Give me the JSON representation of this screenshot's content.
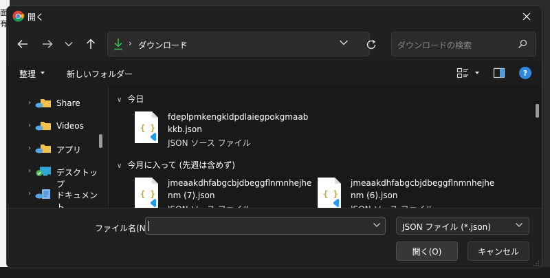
{
  "background": {
    "left_text": [
      "面",
      "有"
    ]
  },
  "window": {
    "title": "開く"
  },
  "nav": {
    "address_folder": "ダウンロード",
    "address_separator": "›",
    "search_placeholder": "ダウンロードの検索"
  },
  "toolbar": {
    "organize_label": "整理",
    "new_folder_label": "新しいフォルダー",
    "help_label": "?"
  },
  "sidebar": {
    "items": [
      {
        "label": "Share",
        "icon": "cloud-folder-icon"
      },
      {
        "label": "Videos",
        "icon": "cloud-folder-icon"
      },
      {
        "label": "アプリ",
        "icon": "cloud-folder-icon"
      },
      {
        "label": "デスクトップ",
        "icon": "desktop-synced-icon"
      },
      {
        "label": "ドキュメント",
        "icon": "documents-icon"
      }
    ]
  },
  "content": {
    "groups": [
      {
        "header": "今日",
        "files": [
          {
            "name": "fdeplpmkengkldpdlaiegpokgmaabkkb.json",
            "type": "JSON ソース ファイル"
          }
        ]
      },
      {
        "header": "今月に入って (先週は含めず)",
        "files": [
          {
            "name": "jmeaakdhfabgcbjdbeggflnmnhejhenm (7).json",
            "type": "JSON ソース ファイル"
          },
          {
            "name": "jmeaakdhfabgcbjdbeggflnmnhejhenm (6).json",
            "type": "JSON ソース ファイル"
          }
        ]
      }
    ]
  },
  "footer": {
    "filename_label": "ファイル名(N):",
    "filename_value": "",
    "filter_value": "JSON ファイル (*.json)",
    "open_label": "開く(O)",
    "cancel_label": "キャンセル"
  },
  "colors": {
    "accent": "#2e88e0",
    "download_arrow": "#3fb950",
    "folder": "#f0c24b",
    "json_brace": "#c8a52e",
    "vscode_badge": "#1f9cf0"
  }
}
